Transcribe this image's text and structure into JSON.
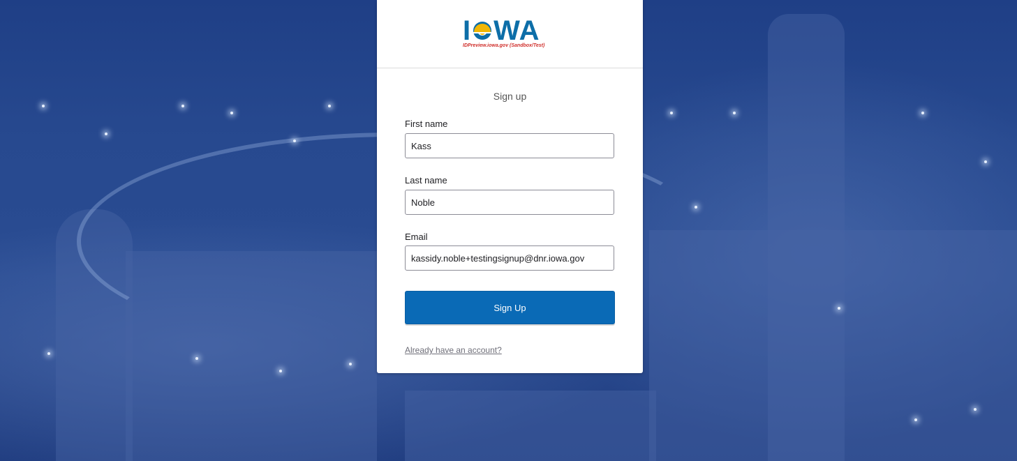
{
  "logo": {
    "word_prefix": "I",
    "word_suffix": "WA",
    "subtitle": "IDPreview.iowa.gov (Sandbox/Test)",
    "brand_color": "#0d6ea8",
    "sun_color": "#f2b705",
    "subtitle_color": "#d0302c"
  },
  "form": {
    "title": "Sign up",
    "first_name": {
      "label": "First name",
      "value": "Kass"
    },
    "last_name": {
      "label": "Last name",
      "value": "Noble"
    },
    "email": {
      "label": "Email",
      "value": "kassidy.noble+testingsignup@dnr.iowa.gov"
    },
    "submit_label": "Sign Up",
    "signin_link": "Already have an account?"
  },
  "colors": {
    "background": "#2a4c92",
    "button": "#0a6ab6"
  }
}
